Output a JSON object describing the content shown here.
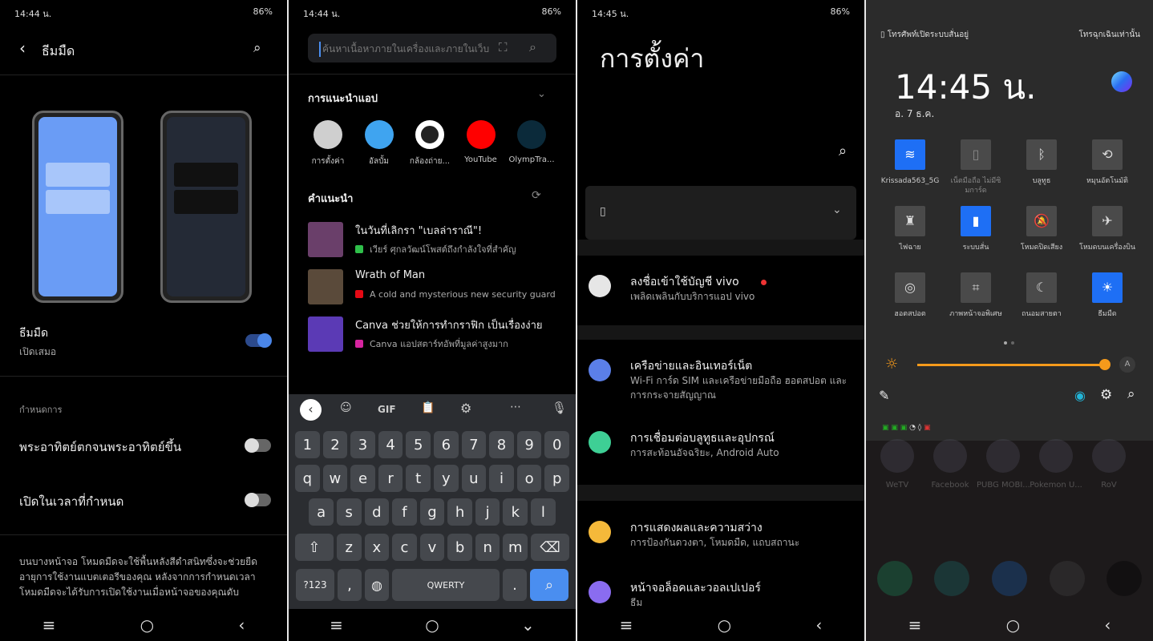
{
  "status": {
    "p1_time": "14:44 น.",
    "p2_time": "14:44 น.",
    "p3_time": "14:45 น.",
    "battery": "86%"
  },
  "dark_theme": {
    "title": "ธีมมืด",
    "row_title": "ธีมมืด",
    "row_sub": "เปิดเสมอ",
    "row_on": true,
    "section": "กำหนดการ",
    "sunset": "พระอาทิตย์ตกจนพระอาทิตย์ขึ้น",
    "sunset_on": false,
    "scheduled": "เปิดในเวลาที่กำหนด",
    "scheduled_on": false,
    "description": "บนบางหน้าจอ โหมดมืดจะใช้พื้นหลังสีดำสนิทซึ่งจะช่วยยืดอายุการใช้งานแบตเตอรีของคุณ หลังจากการกำหนดเวลา โหมดมืดจะได้รับการเปิดใช้งานเมื่อหน้าจอของคุณดับ",
    "accent": "#4a86e8"
  },
  "search": {
    "placeholder": "ค้นหาเนื้อหาภายในเครื่องและภายในเว็บ",
    "apps_title": "การแนะนำแอป",
    "apps": [
      {
        "label": "การตั้งค่า",
        "color": "#cfcfcf"
      },
      {
        "label": "อัลบั้ม",
        "color": "#3fa4f0"
      },
      {
        "label": "กล้องถ่าย...",
        "color": "#ffffff"
      },
      {
        "label": "YouTube",
        "color": "#ff0000"
      },
      {
        "label": "OlympTra...",
        "color": "#0b2a3a"
      }
    ],
    "sugg_title": "คำแนะนำ",
    "suggestions": [
      {
        "title": "ในวันที่เลิกรา \"เบลล่าราณี\"!",
        "sub": "เวียร์ ศุกลวัฒน์โพสต์ถึงกำลังใจที่สำคัญ",
        "src": "#2fbf4a",
        "thumb": "#6a3f6a"
      },
      {
        "title": "Wrath of Man",
        "sub": "A cold and mysterious new security guard",
        "src": "#e50914",
        "thumb": "#5a4a3a"
      },
      {
        "title": "Canva ช่วยให้การทำกราฟิก เป็นเรื่องง่าย",
        "sub": "Canva แอปสตาร์ทอัพที่มูลค่าสูงมาก",
        "src": "#d6249f",
        "thumb": "#5b3ab5"
      }
    ],
    "keyboard": {
      "toolbar": [
        "GIF"
      ],
      "rows": [
        [
          "1",
          "2",
          "3",
          "4",
          "5",
          "6",
          "7",
          "8",
          "9",
          "0"
        ],
        [
          "q",
          "w",
          "e",
          "r",
          "t",
          "y",
          "u",
          "i",
          "o",
          "p"
        ],
        [
          "a",
          "s",
          "d",
          "f",
          "g",
          "h",
          "j",
          "k",
          "l"
        ],
        [
          "z",
          "x",
          "c",
          "v",
          "b",
          "n",
          "m"
        ]
      ],
      "sym": "?123",
      "comma": ",",
      "space": "QWERTY",
      "period": ".",
      "accent": "#4a8ef0"
    }
  },
  "settings": {
    "title": "การตั้งค่า",
    "items": [
      {
        "title": "ลงชื่อเข้าใช้บัญชี vivo",
        "sub": "เพลิดเพลินกับบริการแอป vivo",
        "color": "#e6e6e6"
      },
      {
        "title": "เครือข่ายและอินเทอร์เน็ต",
        "sub": "Wi-Fi การ์ด SIM และเครือข่ายมือถือ ฮอตสปอต และการกระจายสัญญาณ",
        "color": "#5b7fe8"
      },
      {
        "title": "การเชื่อมต่อบลูทูธและอุปกรณ์",
        "sub": "การสะท้อนอัจฉริยะ, Android Auto",
        "color": "#3ecf95"
      },
      {
        "title": "การแสดงผลและความสว่าง",
        "sub": "การป้องกันดวงตา, โหมดมืด, แถบสถานะ",
        "color": "#f5b93a"
      },
      {
        "title": "หน้าจอล็อคและวอลเปเปอร์",
        "sub": "ธีม",
        "color": "#8a6cf0"
      }
    ]
  },
  "quick": {
    "vibrate_status": "โทรศัพท์เปิดระบบสั่นอยู่",
    "emergency": "โทรฉุกเฉินเท่านั้น",
    "clock": "14:45 น.",
    "date": "อ. 7 ธ.ค.",
    "tiles": [
      {
        "label": "Krissada563_5G",
        "icon": "wifi-icon",
        "g": "≋",
        "state": "on"
      },
      {
        "label": "เน็ตมือถือ ไม่มีซิมการ์ด",
        "icon": "no-sim-icon",
        "g": "▯",
        "state": "off"
      },
      {
        "label": "บลูทูธ",
        "icon": "bluetooth-icon",
        "g": "ᛒ",
        "state": "idle"
      },
      {
        "label": "หมุนอัตโนมัติ",
        "icon": "rotate-icon",
        "g": "⟲",
        "state": "idle"
      },
      {
        "label": "ไฟฉาย",
        "icon": "flashlight-icon",
        "g": "♜",
        "state": "idle"
      },
      {
        "label": "ระบบสั่น",
        "icon": "vibrate-icon",
        "g": "▮",
        "state": "on"
      },
      {
        "label": "โหมดปิดเสียง",
        "icon": "mute-bell-icon",
        "g": "🔕",
        "state": "idle"
      },
      {
        "label": "โหมดบนเครื่องบิน",
        "icon": "airplane-icon",
        "g": "✈",
        "state": "idle"
      },
      {
        "label": "ฮอตสปอต",
        "icon": "hotspot-icon",
        "g": "◎",
        "state": "idle"
      },
      {
        "label": "ภาพหน้าจอพิเศษ",
        "icon": "screenshot-icon",
        "g": "⌗",
        "state": "idle"
      },
      {
        "label": "ถนอมสายตา",
        "icon": "moon-icon",
        "g": "☾",
        "state": "idle"
      },
      {
        "label": "ธีมมืด",
        "icon": "dark-theme-icon",
        "g": "☀",
        "state": "on"
      }
    ],
    "brightness": 100,
    "auto": "A",
    "slider_color": "#f59a1b",
    "home_apps": [
      "WeTV",
      "Facebook",
      "PUBG MOBI...",
      "Pokemon U...",
      "RoV"
    ]
  }
}
